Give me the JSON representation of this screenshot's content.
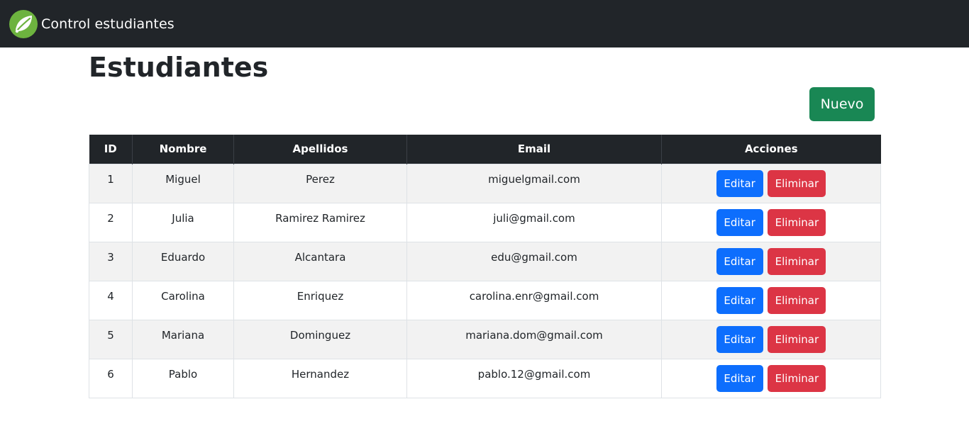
{
  "navbar": {
    "title": "Control estudiantes",
    "logo_icon": "spring-leaf-icon",
    "background": "#212529",
    "logo_color": "#6db33f"
  },
  "page": {
    "title": "Estudiantes",
    "new_button_label": "Nuevo"
  },
  "table": {
    "headers": {
      "id": "ID",
      "nombre": "Nombre",
      "apellidos": "Apellidos",
      "email": "Email",
      "acciones": "Acciones"
    },
    "edit_label": "Editar",
    "delete_label": "Eliminar",
    "rows": [
      {
        "id": "1",
        "nombre": "Miguel",
        "apellidos": "Perez",
        "email": "miguelgmail.com"
      },
      {
        "id": "2",
        "nombre": "Julia",
        "apellidos": "Ramirez Ramirez",
        "email": "juli@gmail.com"
      },
      {
        "id": "3",
        "nombre": "Eduardo",
        "apellidos": "Alcantara",
        "email": "edu@gmail.com"
      },
      {
        "id": "4",
        "nombre": "Carolina",
        "apellidos": "Enriquez",
        "email": "carolina.enr@gmail.com"
      },
      {
        "id": "5",
        "nombre": "Mariana",
        "apellidos": "Dominguez",
        "email": "mariana.dom@gmail.com"
      },
      {
        "id": "6",
        "nombre": "Pablo",
        "apellidos": "Hernandez",
        "email": "pablo.12@gmail.com"
      }
    ]
  },
  "colors": {
    "new_button": "#198754",
    "edit_button": "#0d6efd",
    "delete_button": "#dc3545",
    "table_header": "#212529"
  }
}
